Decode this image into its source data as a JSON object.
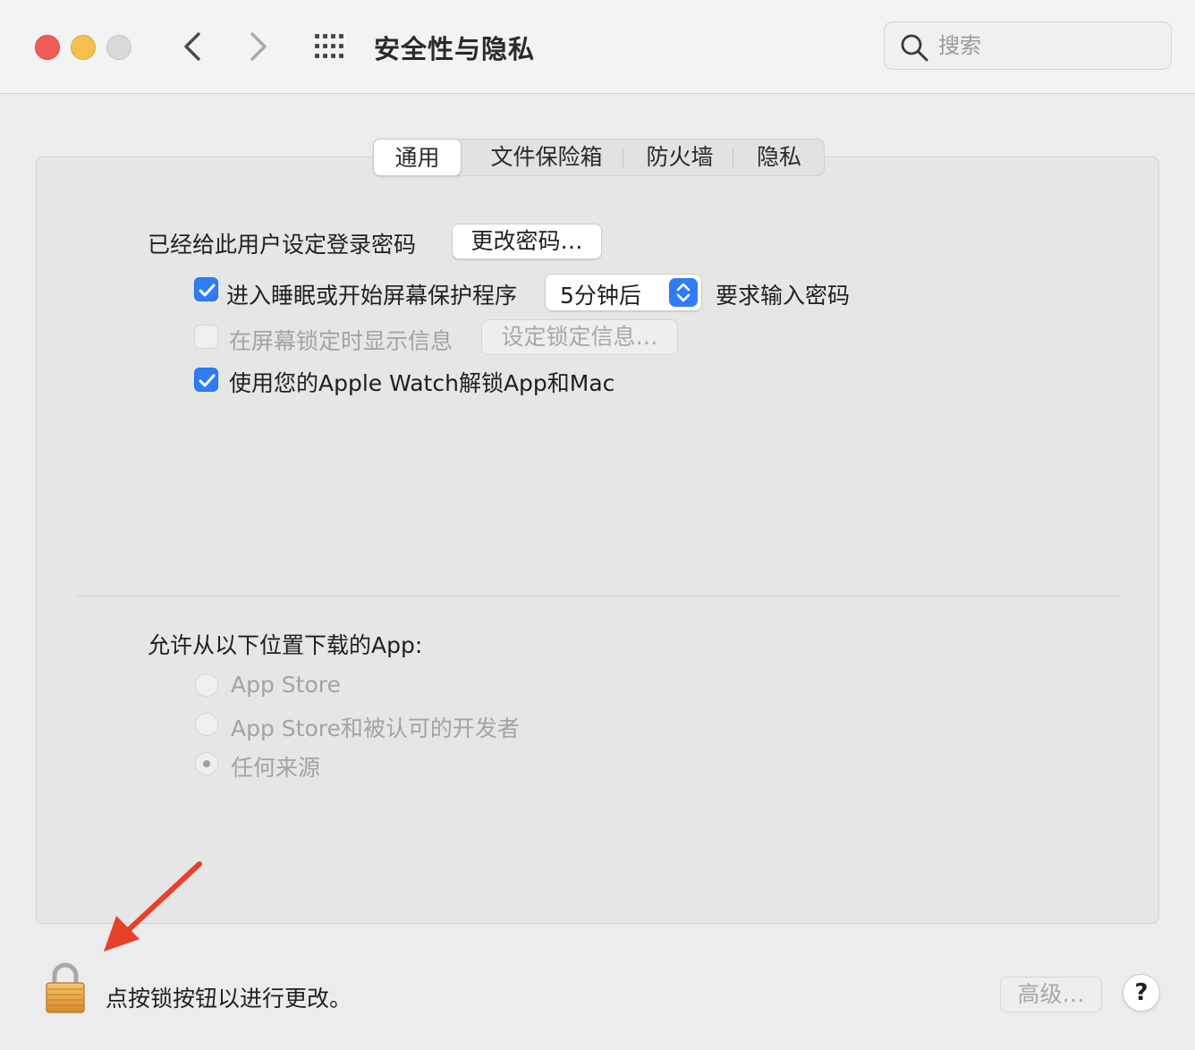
{
  "window": {
    "title": "安全性与隐私",
    "search": {
      "placeholder": "搜索",
      "value": ""
    }
  },
  "tabs": [
    {
      "label": "通用",
      "selected": true
    },
    {
      "label": "文件保险箱",
      "selected": false
    },
    {
      "label": "防火墙",
      "selected": false
    },
    {
      "label": "隐私",
      "selected": false
    }
  ],
  "general": {
    "password_set_label": "已经给此用户设定登录密码",
    "change_password_button": "更改密码…",
    "require_password": {
      "checked": true,
      "label": "进入睡眠或开始屏幕保护程序",
      "delay_value": "5分钟后",
      "suffix": "要求输入密码"
    },
    "show_message": {
      "checked": false,
      "enabled": false,
      "label": "在屏幕锁定时显示信息",
      "button": "设定锁定信息…"
    },
    "apple_watch": {
      "checked": true,
      "label": "使用您的Apple Watch解锁App和Mac"
    }
  },
  "downloads": {
    "heading": "允许从以下位置下载的App:",
    "options": [
      {
        "label": "App Store",
        "selected": false
      },
      {
        "label": "App Store和被认可的开发者",
        "selected": false
      },
      {
        "label": "任何来源",
        "selected": true
      }
    ]
  },
  "footer": {
    "lock_text": "点按锁按钮以进行更改。",
    "advanced_button": "高级…",
    "help_button": "?"
  },
  "colors": {
    "accent": "#2f7cf6",
    "annotation_arrow": "#e8402b"
  }
}
